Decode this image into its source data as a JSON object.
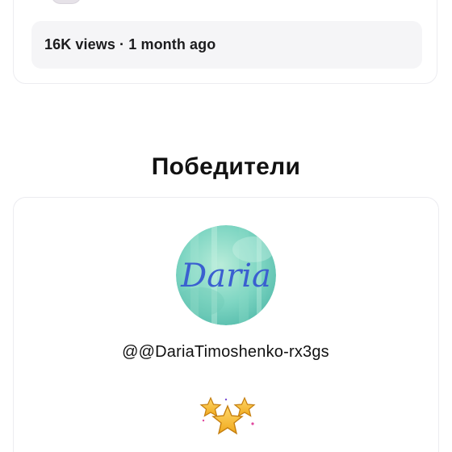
{
  "video": {
    "meta": "16K views · 1 month ago"
  },
  "winners": {
    "title": "Победители",
    "items": [
      {
        "avatar_text": "Daria",
        "username": "@@DariaTimoshenko-rx3gs",
        "award_icon": "stars-icon"
      }
    ]
  },
  "colors": {
    "card_border": "#ececf0",
    "pill_bg": "#f5f5f7",
    "star_gold": "#f5c33b",
    "avatar_text": "#3a5fd0"
  }
}
